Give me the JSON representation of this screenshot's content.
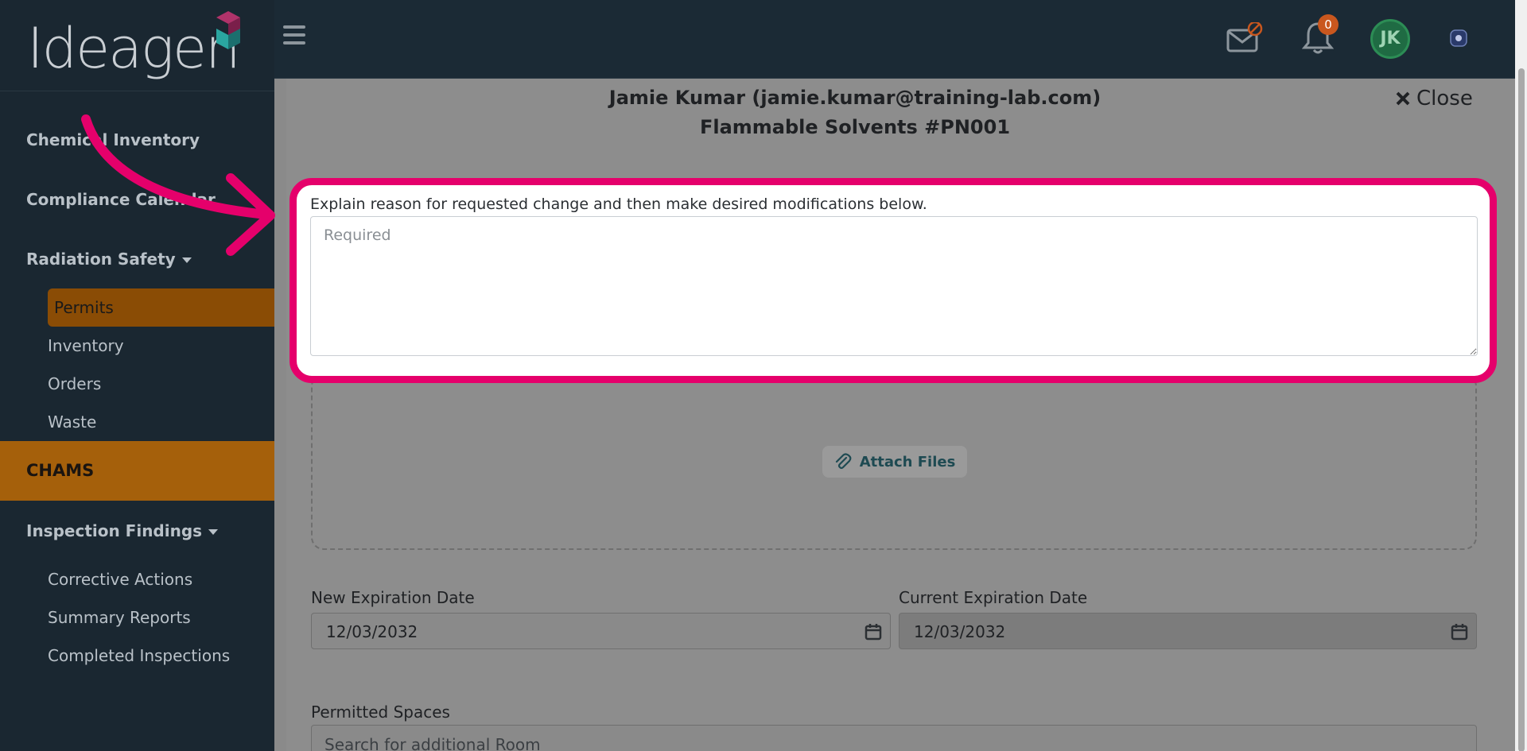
{
  "brand": {
    "logo_text": "Ideagen"
  },
  "sidebar": {
    "items": [
      {
        "label": "Chemical Inventory"
      },
      {
        "label": "Compliance Calendar"
      },
      {
        "label": "Radiation Safety"
      },
      {
        "label": "Permits"
      },
      {
        "label": "Inventory"
      },
      {
        "label": "Orders"
      },
      {
        "label": "Waste"
      },
      {
        "label": "CHAMS"
      },
      {
        "label": "Inspection Findings"
      },
      {
        "label": "Corrective Actions"
      },
      {
        "label": "Summary Reports"
      },
      {
        "label": "Completed Inspections"
      }
    ]
  },
  "topbar": {
    "notifications_count": "0",
    "avatar_initials": "JK"
  },
  "modal": {
    "user_line": "Jamie Kumar (jamie.kumar@training-lab.com)",
    "permit_line": "Flammable Solvents #PN001",
    "close_label": "Close",
    "reason_label": "Explain reason for requested change and then make desired modifications below.",
    "reason_placeholder": "Required",
    "attach_label": "Attach Files",
    "new_expiration_label": "New Expiration Date",
    "new_expiration_value": "12/03/2032",
    "current_expiration_label": "Current Expiration Date",
    "current_expiration_value": "12/03/2032",
    "permitted_spaces_label": "Permitted Spaces",
    "room_search_placeholder": "Search for additional Room"
  },
  "colors": {
    "sidebar_bg": "#1a2731",
    "active_item": "#a5600b",
    "highlight": "#e5006b",
    "badge": "#c9571e"
  }
}
